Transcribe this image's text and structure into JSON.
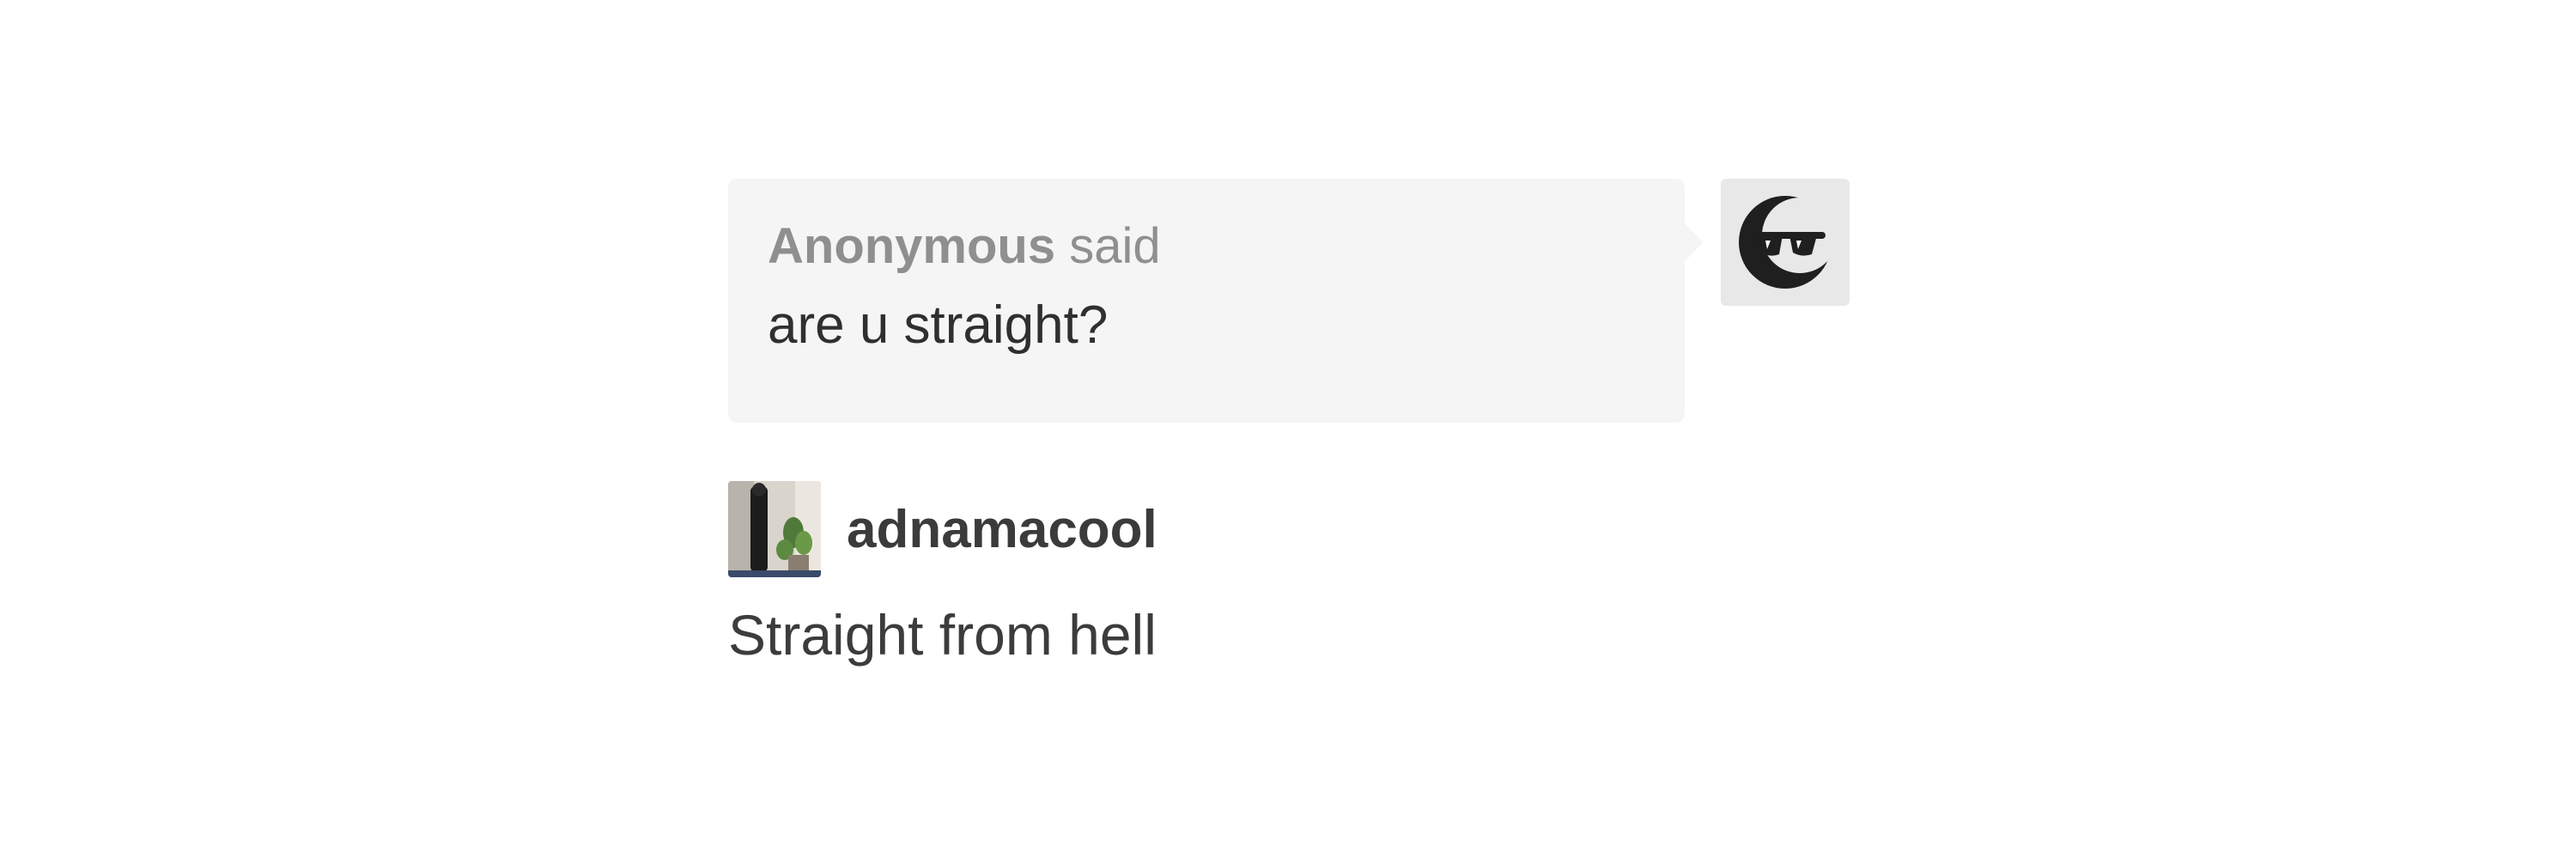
{
  "ask": {
    "asker_name": "Anonymous",
    "said_label": "said",
    "question": "are u straight?",
    "avatar_icon": "anonymous-sunglasses-icon"
  },
  "answer": {
    "blog_name": "adnamacool",
    "text": "Straight from hell",
    "avatar_icon": "blog-avatar-photo"
  },
  "colors": {
    "bubble_background": "#f5f5f5",
    "asker_text": "#8f8f8f",
    "body_text": "#3c3c3c"
  }
}
